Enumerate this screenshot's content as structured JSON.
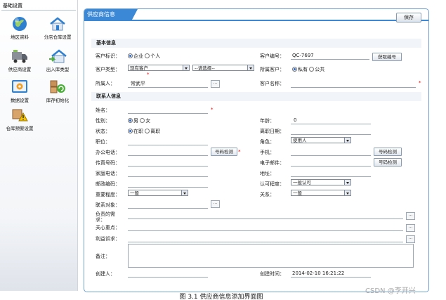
{
  "sidebar": {
    "header": "基础设置",
    "items": [
      {
        "label": "地区资料",
        "icon": "globe-icon"
      },
      {
        "label": "分店仓库设置",
        "icon": "house-icon"
      },
      {
        "label": "供应商设置",
        "icon": "truck-icon"
      },
      {
        "label": "出入库类型",
        "icon": "house-arrow-icon"
      },
      {
        "label": "数据设置",
        "icon": "gear-monitor-icon"
      },
      {
        "label": "库存初始化",
        "icon": "boxes-refresh-icon"
      },
      {
        "label": "仓库预警设置",
        "icon": "box-warning-icon"
      }
    ]
  },
  "tab": {
    "title": "供应商信息"
  },
  "toolbar": {
    "save_label": "保存"
  },
  "basic": {
    "title": "基本信息",
    "customer_flag_label": "客户标识：",
    "flag_options": [
      "企业",
      "个人"
    ],
    "customer_no_label": "客户编号：",
    "customer_no_value": "QC-7697",
    "get_no_button": "获取编号",
    "customer_type_label": "客户类型：",
    "customer_type_value": "现有客户",
    "customer_type_sub": "--请选择--",
    "owner_label": "所属客户：",
    "owner_options": [
      "私有",
      "公共"
    ],
    "belong_person_label": "所属人：",
    "belong_person_value": "常武平",
    "customer_name_label": "客户名称："
  },
  "contact": {
    "title": "联系人信息",
    "name_label": "姓名：",
    "gender_label": "性别：",
    "gender_options": [
      "男",
      "女"
    ],
    "age_label": "年龄：",
    "age_value": "0",
    "status_label": "状态：",
    "status_options": [
      "在职",
      "离职"
    ],
    "leave_date_label": "离职日期：",
    "position_label": "职位：",
    "role_label": "角色：",
    "role_value": "使用人",
    "office_phone_label": "办公电话：",
    "check_button": "号码检测",
    "mobile_label": "手机：",
    "fax_label": "传真号码：",
    "email_label": "电子邮件：",
    "home_phone_label": "家庭电话：",
    "address_label": "地址：",
    "zip_label": "邮政编码：",
    "recognition_label": "认可程度：",
    "recognition_value": "一般认可",
    "importance_label": "重要程度：",
    "importance_value": "一般",
    "relation_label": "关系：",
    "relation_value": "一般",
    "contact_obj_label": "联系对象：",
    "demand_label_1": "负责的需",
    "demand_label_2": "求：",
    "focus_label": "关心重点：",
    "interest_label": "利益诉求：",
    "remark_label": "备注：",
    "creator_label": "创建人：",
    "created_time_label": "创建时间：",
    "created_time_value": "2014-02-10 16:21:22"
  },
  "caption": "图 3.1 供应商信息添加界面图",
  "watermark": "CSDN @李开兴"
}
